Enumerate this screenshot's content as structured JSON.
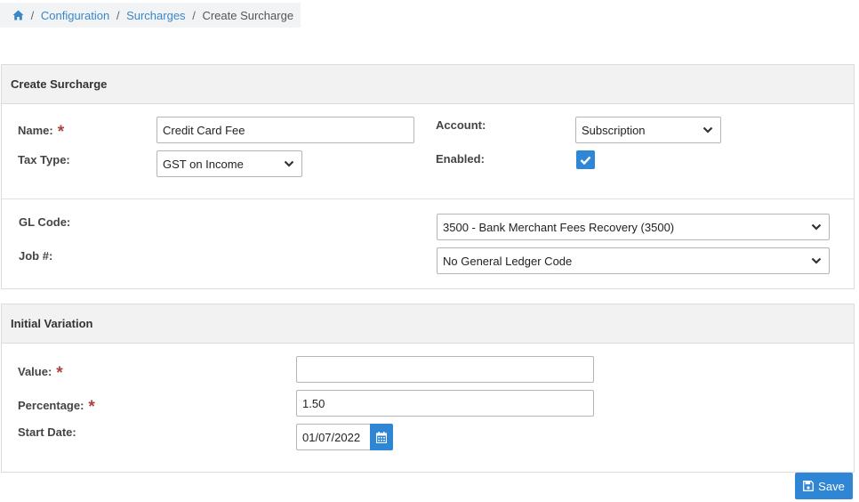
{
  "breadcrumb": {
    "home_icon": "home-icon",
    "items": [
      "Configuration",
      "Surcharges",
      "Create Surcharge"
    ],
    "separator": "/"
  },
  "create_panel": {
    "heading": "Create Surcharge",
    "name_label": "Name:",
    "name_value": "Credit Card Fee",
    "tax_type_label": "Tax Type:",
    "tax_type_value": "GST on Income",
    "account_label": "Account:",
    "account_value": "Subscription",
    "enabled_label": "Enabled:",
    "enabled_checked": true,
    "gl_code_label": "GL Code:",
    "gl_code_value": "3500 - Bank Merchant Fees Recovery (3500)",
    "job_label": "Job #:",
    "job_value": "No General Ledger Code"
  },
  "variation_panel": {
    "heading": "Initial Variation",
    "value_label": "Value:",
    "value_value": "",
    "percentage_label": "Percentage:",
    "percentage_value": "1.50",
    "start_date_label": "Start Date:",
    "start_date_value": "01/07/2022"
  },
  "required_marker": "*",
  "save_label": "Save",
  "colors": {
    "accent": "#2f86d4",
    "link": "#3a87c8",
    "required": "#a94442",
    "panel_heading_bg": "#f2f2f2"
  }
}
